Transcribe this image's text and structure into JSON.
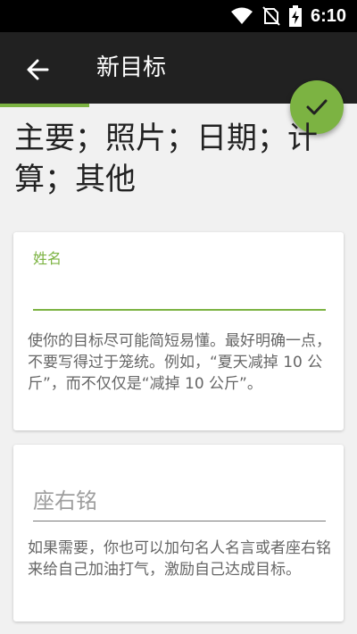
{
  "status_bar": {
    "time": "6:10"
  },
  "app_bar": {
    "title": "新目标"
  },
  "progress": {
    "fraction": 0.25
  },
  "colors": {
    "accent": "#7cb342",
    "appbar": "#212121"
  },
  "section_title": "主要；照片；日期；计算；其他",
  "name_card": {
    "label": "姓名",
    "value": "",
    "help": "使你的目标尽可能简短易懂。最好明确一点，不要写得过于笼统。例如，“夏天减掉 10 公斤”，而不仅仅是“减掉 10 公斤”。"
  },
  "motto_card": {
    "placeholder": "座右铭",
    "help": "如果需要，你也可以加句名人名言或者座右铭来给自己加油打气，激励自己达成目标。"
  }
}
